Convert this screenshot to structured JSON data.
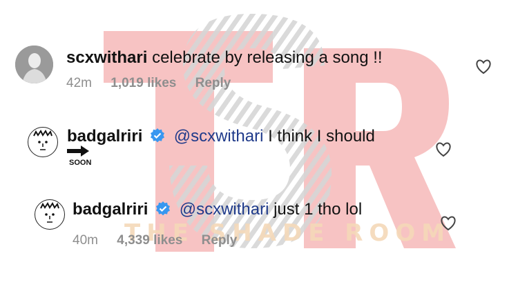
{
  "watermark": {
    "text": "THE SHADE ROOM",
    "logo": "TSR"
  },
  "comments": [
    {
      "username": "scxwithari",
      "text": "celebrate by releasing a song !!",
      "time": "42m",
      "likes": "1,019 likes",
      "reply_label": "Reply"
    },
    {
      "username": "badgalriri",
      "mention": "@scxwithari",
      "text": "I think I should",
      "badge_label": "SOON",
      "verified": true
    },
    {
      "username": "badgalriri",
      "mention": "@scxwithari",
      "text": "just 1 tho lol",
      "time": "40m",
      "likes": "4,339 likes",
      "reply_label": "Reply",
      "verified": true
    }
  ],
  "colors": {
    "verified": "#3897f0",
    "mention": "#1f3a8a",
    "meta": "#8e8e8e",
    "watermark_red": "#f4b3b3"
  },
  "icons": [
    "heart-icon",
    "verified-icon",
    "arrow-right-icon"
  ]
}
